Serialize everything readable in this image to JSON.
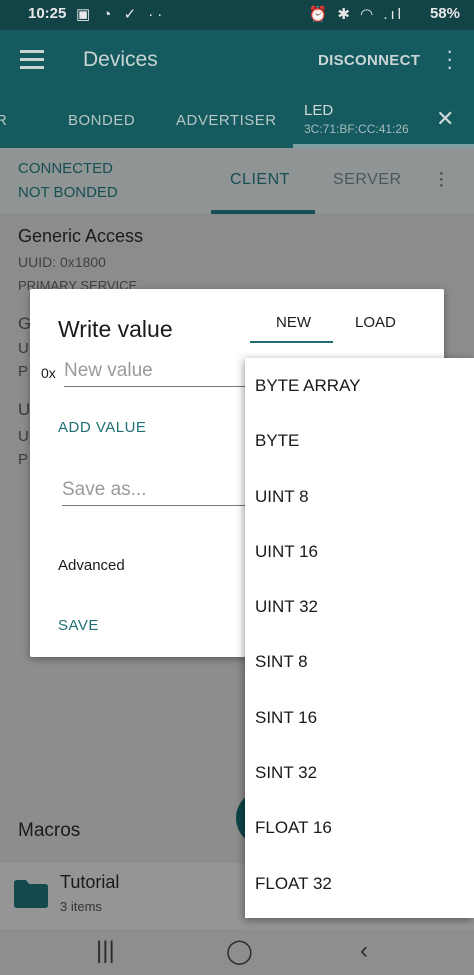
{
  "status_bar": {
    "time": "10:25",
    "battery": "58%"
  },
  "app_bar": {
    "title": "Devices",
    "disconnect_label": "DISCONNECT"
  },
  "tabs": {
    "items": [
      "R",
      "BONDED",
      "ADVERTISER"
    ],
    "active_name": "LED",
    "active_mac": "3C:71:BF:CC:41:26"
  },
  "connection": {
    "status": "CONNECTED",
    "bond": "NOT BONDED",
    "tab_client": "CLIENT",
    "tab_server": "SERVER"
  },
  "services": [
    {
      "name": "Generic Access",
      "uuid": "UUID: 0x1800",
      "type": "PRIMARY SERVICE"
    }
  ],
  "side_letters": [
    "G",
    "U",
    "P",
    "U",
    "U",
    "P"
  ],
  "macros": {
    "heading": "Macros",
    "folder_name": "Tutorial",
    "folder_count": "3 items"
  },
  "dialog": {
    "title": "Write value",
    "tab_new": "NEW",
    "tab_load": "LOAD",
    "prefix": "0x",
    "value_placeholder": "New value",
    "add_value": "ADD VALUE",
    "save_as_placeholder": "Save as...",
    "advanced": "Advanced",
    "save": "SAVE"
  },
  "dropdown": {
    "options": [
      "BYTE ARRAY",
      "BYTE",
      "UINT 8",
      "UINT 16",
      "UINT 32",
      "SINT 8",
      "SINT 16",
      "SINT 32",
      "FLOAT 16",
      "FLOAT 32"
    ]
  },
  "colors": {
    "appbar": "#145a5e",
    "accent": "#1f6e73",
    "statusbar": "#124346"
  }
}
